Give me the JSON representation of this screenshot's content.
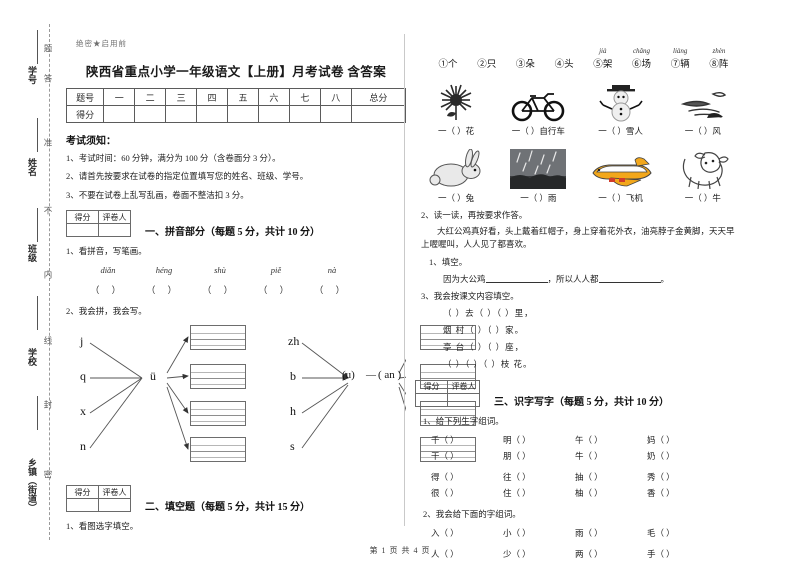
{
  "document": {
    "secret_mark": "绝密★启用前",
    "title": "陕西省重点小学一年级语文【上册】月考试卷 含答案",
    "footer": "第 1 页 共 4 页"
  },
  "seal_margin": {
    "vertical_notice": "密封线内不准答题",
    "fields": [
      "学号",
      "姓名",
      "班级",
      "学校",
      "乡镇（街道）"
    ]
  },
  "score_table": {
    "row_labels": [
      "题号",
      "得分"
    ],
    "columns": [
      "一",
      "二",
      "三",
      "四",
      "五",
      "六",
      "七",
      "八",
      "总分"
    ]
  },
  "notice": {
    "title": "考试须知：",
    "items": [
      "1、考试时间：60 分钟，满分为 100 分（含卷面分 3 分）。",
      "2、请首先按要求在试卷的指定位置填写您的姓名、班级、学号。",
      "3、不要在试卷上乱写乱画，卷面不整洁扣 3 分。"
    ]
  },
  "grader_box": {
    "score_label": "得分",
    "grader_label": "评卷人"
  },
  "sections": {
    "one": {
      "title": "一、拼音部分（每题 5 分，共计 10 分）",
      "q1": "1、看拼音，写笔画。",
      "pinyin": [
        "diǎn",
        "héng",
        "shù",
        "piě",
        "nà"
      ],
      "answer_parens": [
        "（    ）",
        "（    ）",
        "（    ）",
        "（    ）",
        "（    ）"
      ],
      "q2": "2、我会拼，我会写。",
      "diagram_left": {
        "initials": [
          "j",
          "q",
          "x",
          "n"
        ],
        "final": "ü",
        "box_count": 4
      },
      "diagram_right": {
        "initials": [
          "zh",
          "b",
          "h",
          "s"
        ],
        "medial": "(u)",
        "final": "( an )",
        "box_count": 4
      }
    },
    "two": {
      "title": "二、填空题（每题 5 分，共计 15 分）",
      "q1": "1、看图选字填空。"
    },
    "three": {
      "title": "三、识字写字（每题 5 分，共计 10 分）",
      "q1": "1、给下列生字组词。",
      "q1_rows": [
        [
          "千（      ）",
          "明（      ）",
          "午（      ）",
          "妈（      ）"
        ],
        [
          "干（      ）",
          "朋（      ）",
          "牛（      ）",
          "奶（      ）"
        ],
        [
          "得（      ）",
          "往（      ）",
          "抽（      ）",
          "秀（      ）"
        ],
        [
          "很（      ）",
          "住（      ）",
          "柚（      ）",
          "香（      ）"
        ]
      ],
      "q2": "2、我会给下面的字组词。",
      "q2_rows": [
        [
          "入（      ）",
          "小（      ）",
          "雨（      ）",
          "毛（      ）"
        ],
        [
          "人（      ）",
          "少（      ）",
          "两（      ）",
          "手（      ）"
        ]
      ]
    }
  },
  "measure_words": {
    "items": [
      {
        "num": "①",
        "word": "个",
        "pinyin": ""
      },
      {
        "num": "②",
        "word": "只",
        "pinyin": ""
      },
      {
        "num": "③",
        "word": "朵",
        "pinyin": ""
      },
      {
        "num": "④",
        "word": "头",
        "pinyin": ""
      },
      {
        "num": "⑤",
        "word": "架",
        "pinyin": "jià"
      },
      {
        "num": "⑥",
        "word": "场",
        "pinyin": "chǎng"
      },
      {
        "num": "⑦",
        "word": "辆",
        "pinyin": "liàng"
      },
      {
        "num": "⑧",
        "word": "阵",
        "pinyin": "zhèn"
      }
    ]
  },
  "picture_rows": [
    [
      {
        "icon": "sunflower-icon",
        "caption": "一（    ）花"
      },
      {
        "icon": "bicycle-icon",
        "caption": "一（    ）自行车"
      },
      {
        "icon": "snowman-icon",
        "caption": "一（    ）雪人"
      },
      {
        "icon": "wind-icon",
        "caption": "一（  ）风"
      }
    ],
    [
      {
        "icon": "rabbit-icon",
        "caption": "一（  ）兔"
      },
      {
        "icon": "rain-icon",
        "caption": "一（    ）雨"
      },
      {
        "icon": "airplane-icon",
        "caption": "一（    ）飞机"
      },
      {
        "icon": "cow-icon",
        "caption": "一（    ）牛"
      }
    ]
  ],
  "reading": {
    "q2": "2、读一读，再按要求作答。",
    "passage": "大红公鸡真好看，头上戴着红帽子，身上穿着花外衣，油亮脖子金黄脚，天天早上喔喔叫，人人见了都喜欢。",
    "sub1_label": "1、填空。",
    "sub1_text_a": "因为大公鸡",
    "sub1_text_b": "，所以人人都",
    "sub1_text_c": "。",
    "q3": "3、我会按课文内容填空。",
    "poem_lines": [
      "（      ）去（      ）（      ）里，",
      "烟     村（      ）（      ）家。",
      "亭     台（      ）（      ）座，",
      "（      ）（      ）（        ）枝  花。"
    ]
  }
}
